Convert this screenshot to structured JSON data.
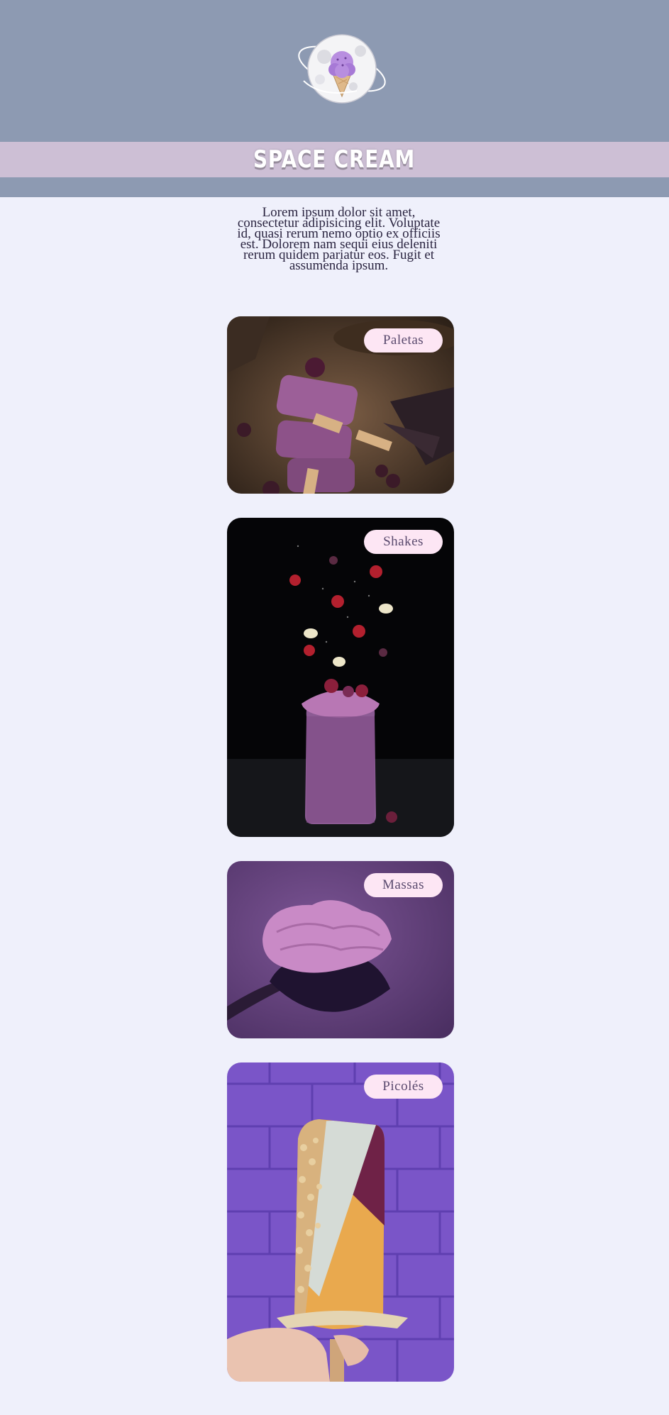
{
  "header": {
    "logo_icon": "ice-cream-planet-icon",
    "title": "SPACE CREAM"
  },
  "intro": {
    "text": "Lorem ipsum dolor sit amet, consectetur adipisicing elit. Voluptate id, quasi rerum nemo optio ex officiis est. Dolorem nam sequi eius deleniti rerum quidem pariatur eos. Fugit et assumenda ipsum."
  },
  "cards": [
    {
      "label": "Paletas"
    },
    {
      "label": "Shakes"
    },
    {
      "label": "Massas"
    },
    {
      "label": "Picolés"
    }
  ],
  "colors": {
    "header_bg": "#8d9ab2",
    "title_band": "#cdbfd5",
    "page_bg": "#eff0fb",
    "label_bg": "#fde6f4"
  }
}
